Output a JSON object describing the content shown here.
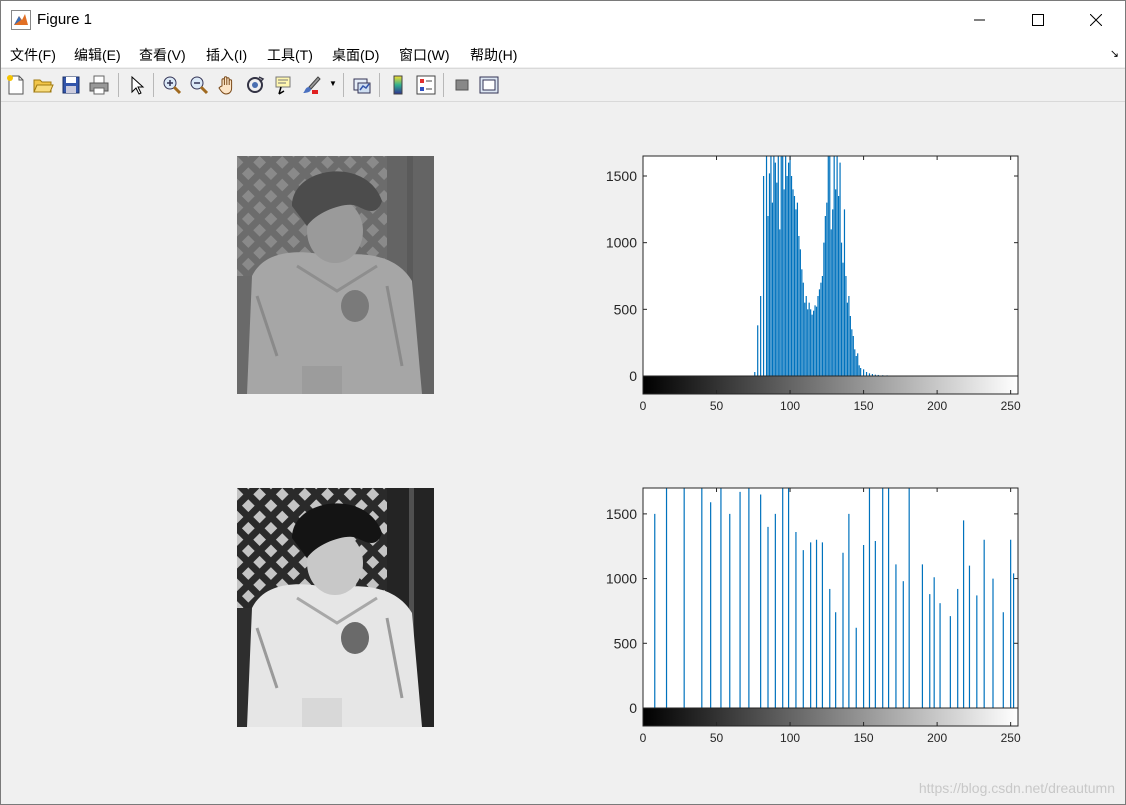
{
  "window": {
    "title": "Figure 1"
  },
  "menu": [
    "文件(F)",
    "编辑(E)",
    "查看(V)",
    "插入(I)",
    "工具(T)",
    "桌面(D)",
    "窗口(W)",
    "帮助(H)"
  ],
  "toolbar_icons": [
    "new-figure-icon",
    "open-file-icon",
    "save-icon",
    "print-icon",
    "select-arrow-icon",
    "zoom-in-icon",
    "zoom-out-icon",
    "pan-hand-icon",
    "rotate-3d-icon",
    "data-cursor-icon",
    "brush-icon",
    "link-plot-icon",
    "colorbar-icon",
    "legend-icon",
    "hide-tools-icon",
    "show-tools-icon"
  ],
  "watermark": "https://blog.csdn.net/dreautumn",
  "colors": {
    "series": "#0072bd",
    "axis": "#262626"
  },
  "chart_data": [
    {
      "type": "bar",
      "ylim": [
        0,
        1650
      ],
      "xlim": [
        0,
        255
      ],
      "yticks": [
        0,
        500,
        1000,
        1500
      ],
      "xticks": [
        0,
        50,
        100,
        150,
        200,
        250
      ],
      "colorbar": "gray",
      "bins": [
        76,
        78,
        80,
        82,
        84,
        85,
        86,
        87,
        88,
        89,
        90,
        91,
        92,
        93,
        94,
        95,
        96,
        97,
        98,
        99,
        100,
        101,
        102,
        103,
        104,
        105,
        106,
        107,
        108,
        109,
        110,
        111,
        112,
        113,
        114,
        115,
        116,
        117,
        118,
        119,
        120,
        121,
        122,
        123,
        124,
        125,
        126,
        127,
        128,
        129,
        130,
        131,
        132,
        133,
        134,
        135,
        136,
        137,
        138,
        139,
        140,
        141,
        142,
        143,
        144,
        145,
        146,
        147,
        148,
        150,
        152,
        154,
        156,
        158,
        160,
        163,
        166,
        170
      ],
      "values": [
        30,
        380,
        600,
        1500,
        1650,
        1200,
        1520,
        1650,
        1300,
        1650,
        1600,
        1450,
        1650,
        1100,
        1650,
        1650,
        1400,
        1650,
        1500,
        1600,
        1650,
        1500,
        1400,
        1350,
        1250,
        1300,
        1050,
        950,
        800,
        700,
        550,
        600,
        500,
        550,
        500,
        460,
        490,
        530,
        520,
        600,
        650,
        700,
        750,
        1000,
        1200,
        1300,
        1650,
        1650,
        1100,
        1250,
        1650,
        1400,
        1650,
        1350,
        1600,
        1000,
        850,
        1250,
        750,
        550,
        600,
        450,
        350,
        300,
        200,
        150,
        170,
        80,
        60,
        50,
        30,
        20,
        15,
        10,
        8,
        6,
        5,
        3
      ]
    },
    {
      "type": "bar",
      "ylim": [
        0,
        1700
      ],
      "xlim": [
        0,
        255
      ],
      "yticks": [
        0,
        500,
        1000,
        1500
      ],
      "xticks": [
        0,
        50,
        100,
        150,
        200,
        250
      ],
      "colorbar": "gray",
      "bins": [
        8,
        16,
        28,
        40,
        46,
        53,
        59,
        66,
        72,
        80,
        85,
        90,
        95,
        99,
        104,
        109,
        114,
        118,
        122,
        127,
        131,
        136,
        140,
        145,
        150,
        154,
        158,
        163,
        167,
        172,
        177,
        181,
        190,
        195,
        198,
        202,
        209,
        214,
        218,
        222,
        227,
        232,
        238,
        245,
        250,
        252
      ],
      "values": [
        1500,
        1700,
        1700,
        1700,
        1590,
        1700,
        1500,
        1670,
        1700,
        1650,
        1400,
        1500,
        1700,
        1700,
        1360,
        1220,
        1280,
        1300,
        1280,
        920,
        740,
        1200,
        1500,
        620,
        1260,
        1700,
        1290,
        1700,
        1700,
        1110,
        980,
        1700,
        1110,
        880,
        1010,
        810,
        710,
        920,
        1450,
        1100,
        870,
        1300,
        1000,
        740,
        1300,
        1040
      ]
    }
  ]
}
